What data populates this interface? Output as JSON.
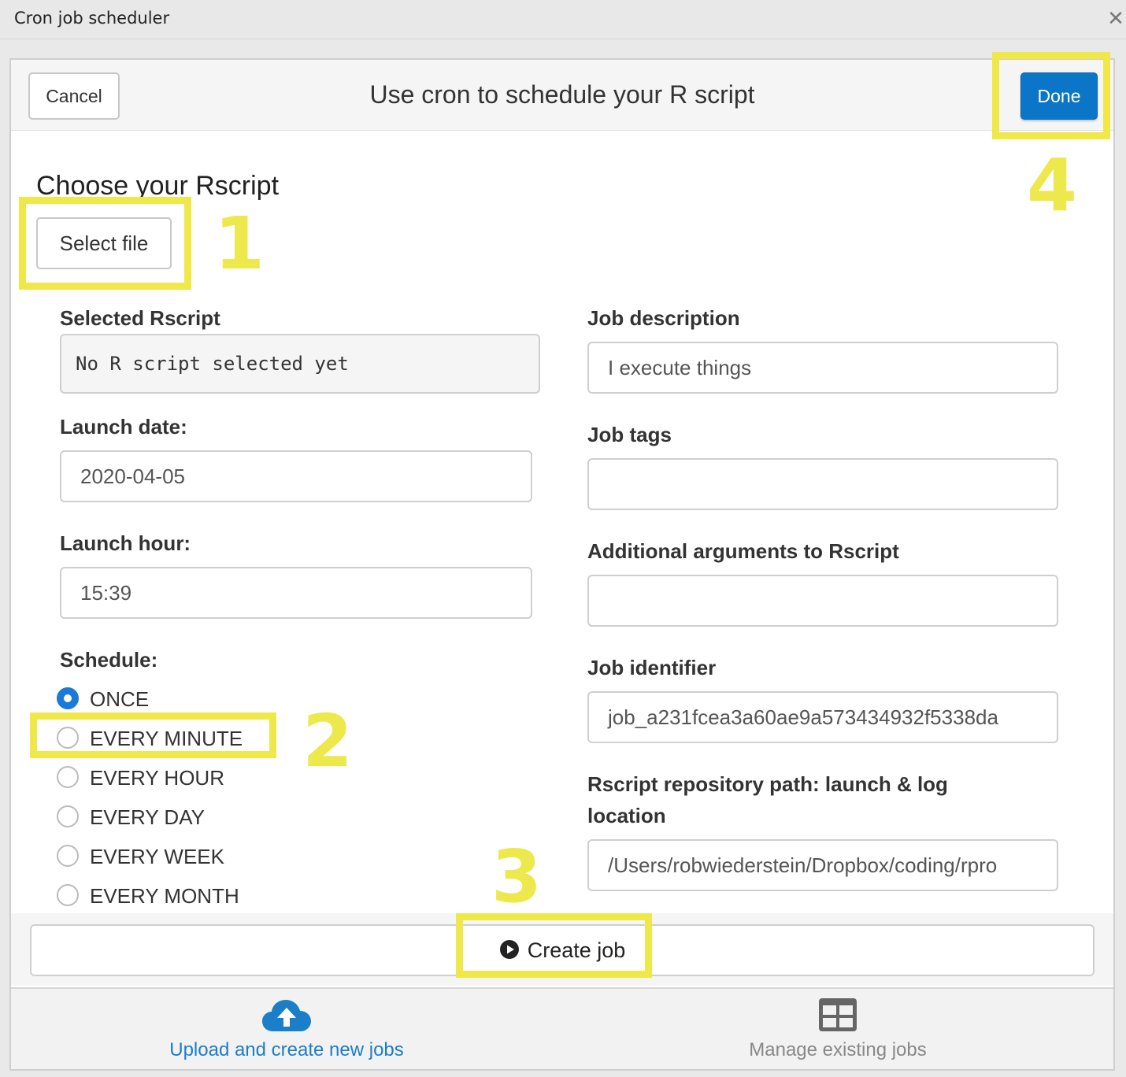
{
  "window": {
    "title": "Cron job scheduler",
    "close_symbol": "✕"
  },
  "header": {
    "cancel_label": "Cancel",
    "heading": "Use cron to schedule your R script",
    "done_label": "Done"
  },
  "choose": {
    "title": "Choose your Rscript",
    "select_label": "Select file"
  },
  "left": {
    "selected_label": "Selected Rscript",
    "selected_value": "No R script selected yet",
    "date_label": "Launch date:",
    "date_value": "2020-04-05",
    "hour_label": "Launch hour:",
    "hour_value": "15:39",
    "schedule_label": "Schedule:",
    "schedule_options": [
      "ONCE",
      "EVERY MINUTE",
      "EVERY HOUR",
      "EVERY DAY",
      "EVERY WEEK",
      "EVERY MONTH"
    ],
    "schedule_selected": "ONCE"
  },
  "right": {
    "desc_label": "Job description",
    "desc_value": "I execute things",
    "tags_label": "Job tags",
    "tags_value": "",
    "args_label": "Additional arguments to Rscript",
    "args_value": "",
    "id_label": "Job identifier",
    "id_value": "job_a231fcea3a60ae9a573434932f5338da",
    "path_label_line1": "Rscript repository path: launch & log",
    "path_label_line2": "location",
    "path_value": "/Users/robwiederstein/Dropbox/coding/rpro"
  },
  "create": {
    "label": "Create job"
  },
  "nav": {
    "upload_label": "Upload and create new jobs",
    "manage_label": "Manage existing jobs"
  },
  "annotations": [
    "1",
    "2",
    "3",
    "4"
  ],
  "colors": {
    "primary": "#0b76c8",
    "link": "#1b7ec9",
    "annotation": "#f0e848",
    "radio_checked": "#1a7ad8"
  }
}
